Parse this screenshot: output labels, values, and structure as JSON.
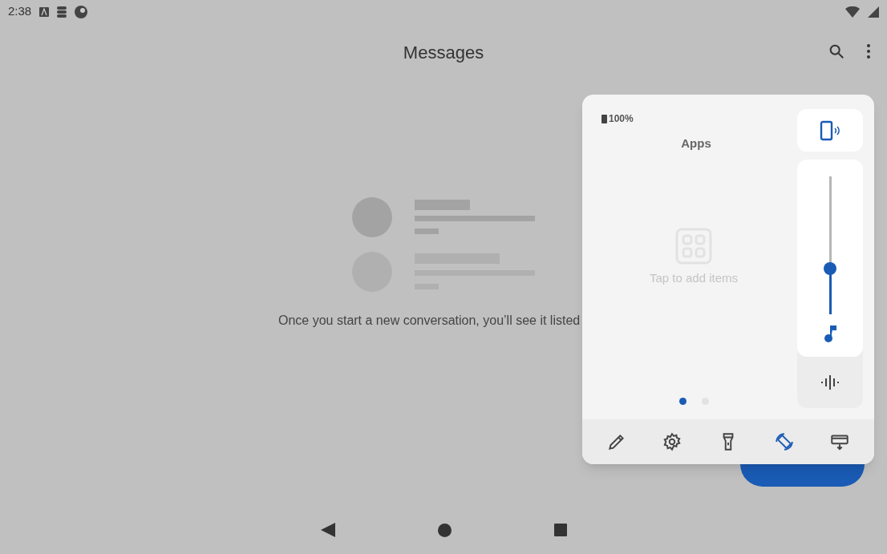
{
  "status_bar": {
    "time": "2:38"
  },
  "app_bar": {
    "title": "Messages"
  },
  "empty_state": {
    "message": "Once you start a new conversation, you’ll see it listed"
  },
  "panel": {
    "battery": "100%",
    "title": "Apps",
    "hint": "Tap to add items",
    "pages": [
      {
        "selected": true
      },
      {
        "selected": false
      }
    ],
    "volume": {
      "level": 0.33
    },
    "tools": [
      {
        "kind": "edit",
        "active": false
      },
      {
        "kind": "settings",
        "active": false
      },
      {
        "kind": "flashlight",
        "active": false
      },
      {
        "kind": "rotate",
        "active": true
      },
      {
        "kind": "screenshot",
        "active": false
      }
    ]
  }
}
